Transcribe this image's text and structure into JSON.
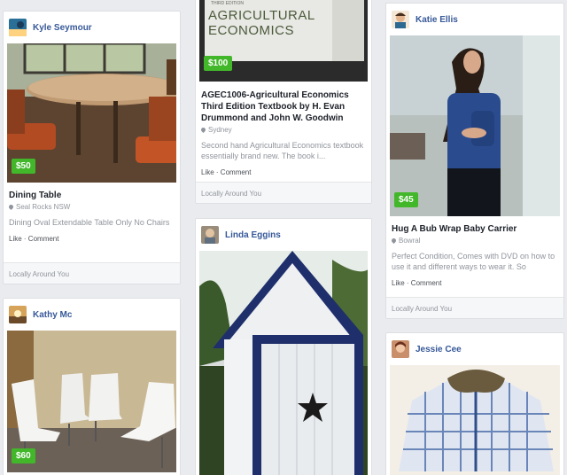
{
  "listings": [
    {
      "seller": "Kyle Seymour",
      "price": "$50",
      "title": "Dining Table",
      "location": "Seal Rocks NSW",
      "description": "Dining Oval Extendable Table Only No Chairs",
      "like": "Like",
      "separator": " · ",
      "comment": "Comment",
      "footer": "Locally Around You"
    },
    {
      "seller": "Kathy Mc",
      "price": "$60"
    },
    {
      "book_edition": "THIRD EDITION",
      "book_title_line1": "AGRICULTURAL",
      "book_title_line2": "ECONOMICS",
      "price": "$100",
      "title": "AGEC1006-Agricultural Economics Third Edition Textbook by H. Evan Drummond and John W. Goodwin",
      "location": "Sydney",
      "description": "Second hand Agricultural Economics textbook essentially brand new. The book i...",
      "like": "Like",
      "separator": " · ",
      "comment": "Comment",
      "footer": "Locally Around You"
    },
    {
      "seller": "Linda Eggins"
    },
    {
      "seller": "Katie Ellis",
      "price": "$45",
      "title": "Hug A Bub Wrap Baby Carrier",
      "location": "Bowral",
      "description": "Perfect Condition, Comes with DVD on how to use it and different ways to wear it. So",
      "like": "Like",
      "separator": " · ",
      "comment": "Comment",
      "footer": "Locally Around You"
    },
    {
      "seller": "Jessie Cee"
    }
  ],
  "colors": {
    "background": "#e9ebee",
    "price_badge": "#42b72a",
    "seller_name": "#365899"
  },
  "icons": [
    "location-pin-icon"
  ]
}
